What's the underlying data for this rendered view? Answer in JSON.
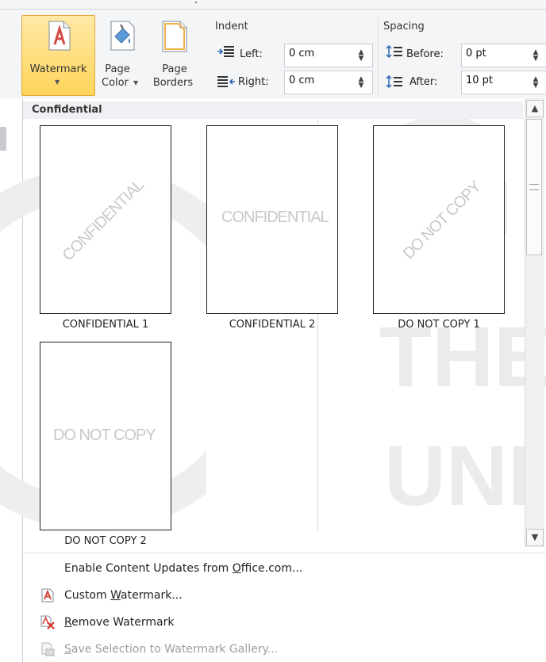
{
  "ribbon": {
    "watermark_label": "Watermark",
    "page_color_label_1": "Page",
    "page_color_label_2": "Color",
    "page_borders_label_1": "Page",
    "page_borders_label_2": "Borders",
    "indent": {
      "title": "Indent",
      "left_label": "Left:",
      "left_value": "0 cm",
      "right_label": "Right:",
      "right_value": "0 cm"
    },
    "spacing": {
      "title": "Spacing",
      "before_label": "Before:",
      "before_value": "0 pt",
      "after_label": "After:",
      "after_value": "10 pt"
    }
  },
  "gallery": {
    "section_title": "Confidential",
    "items": [
      {
        "caption": "CONFIDENTIAL 1",
        "watermark_text": "CONFIDENTIAL",
        "style": "diagonal"
      },
      {
        "caption": "CONFIDENTIAL 2",
        "watermark_text": "CONFIDENTIAL",
        "style": "horizontal"
      },
      {
        "caption": "DO NOT COPY 1",
        "watermark_text": "DO NOT COPY",
        "style": "diagonal"
      },
      {
        "caption": "DO NOT COPY 2",
        "watermark_text": "DO NOT COPY",
        "style": "horizontal"
      }
    ]
  },
  "background_letters": [
    "G",
    "THE",
    "UNI"
  ],
  "menu": {
    "enable_updates_pre": "Enable Content Updates from ",
    "enable_updates_link": "O",
    "enable_updates_post": "ffice.com...",
    "custom_pre": "Custom ",
    "custom_ul": "W",
    "custom_post": "atermark...",
    "remove_ul": "R",
    "remove_post": "emove Watermark",
    "save_ul": "S",
    "save_post": "ave Selection to Watermark Gallery..."
  },
  "colors": {
    "accent_fill": "#ffd45a",
    "accent_border": "#e3a934",
    "disabled_text": "#9c9c9c"
  }
}
